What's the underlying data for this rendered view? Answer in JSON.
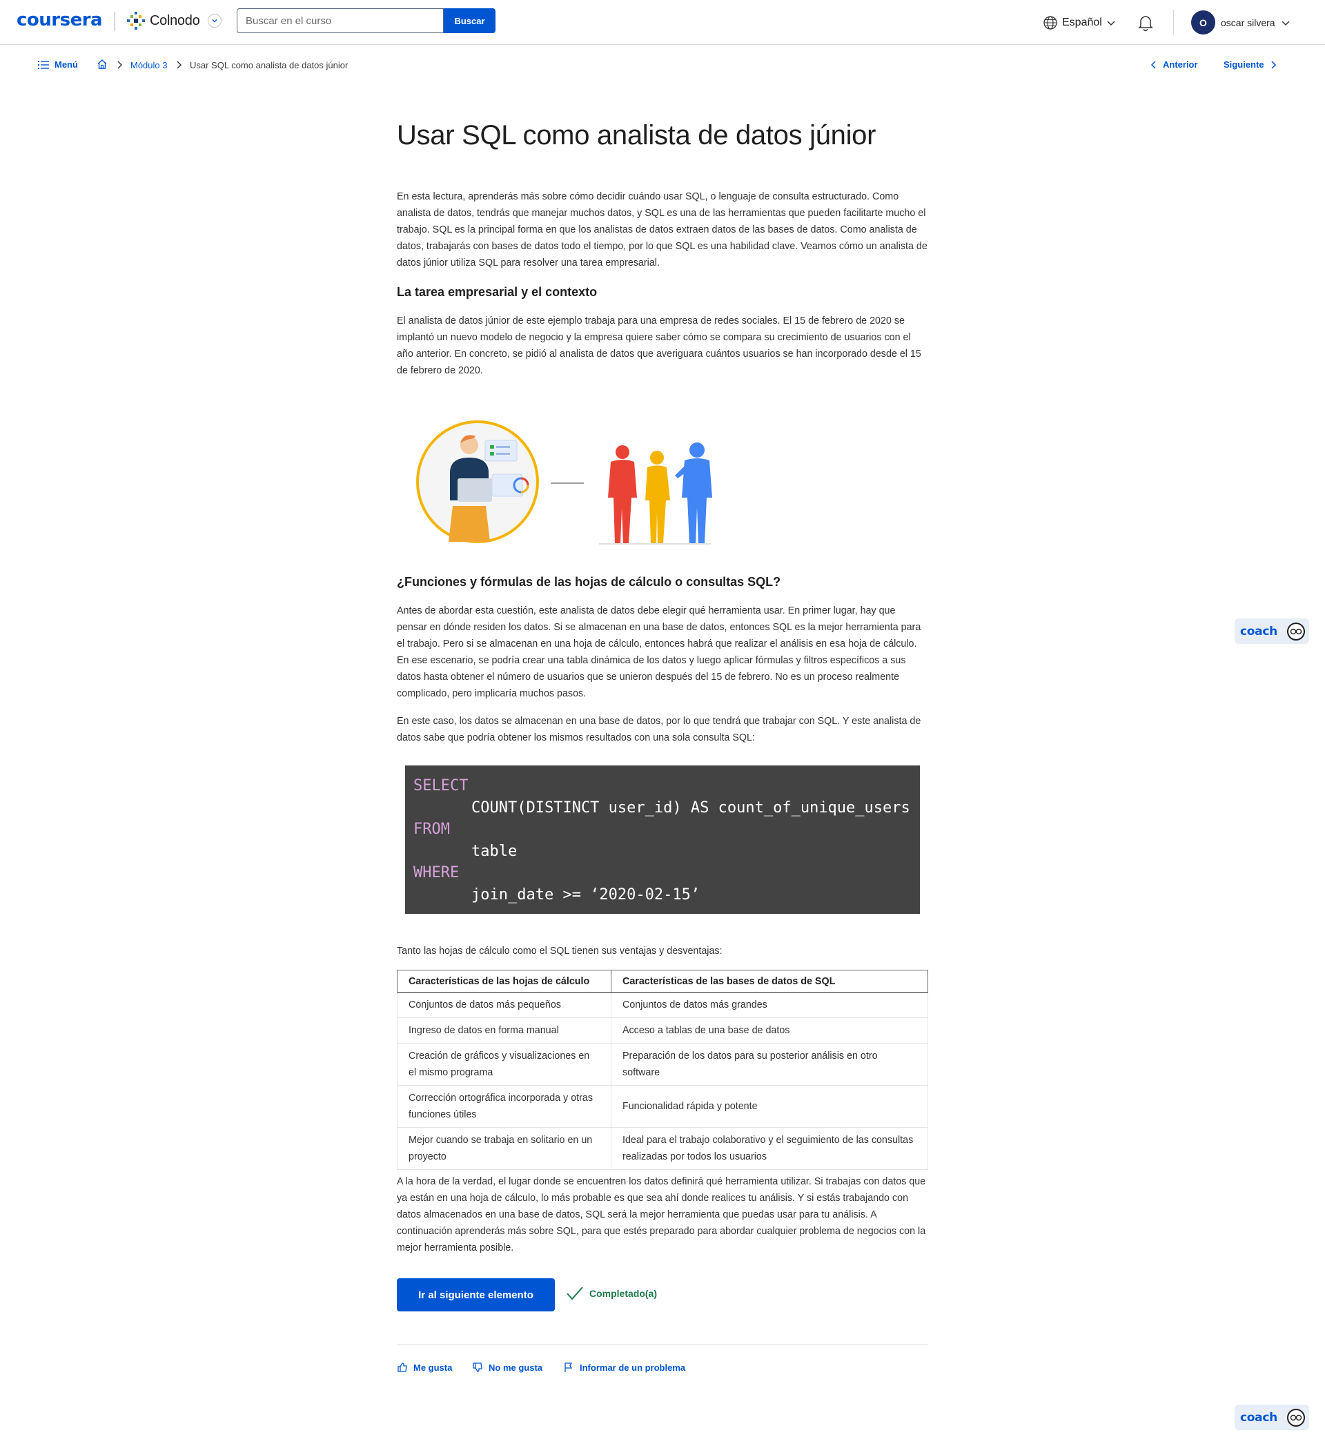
{
  "header": {
    "logo": "coursera",
    "partner": "Colnodo",
    "search_placeholder": "Buscar en el curso",
    "search_button": "Buscar",
    "language": "Español",
    "user_initial": "O",
    "user_name": "oscar silvera"
  },
  "breadcrumb": {
    "menu": "Menú",
    "module": "Módulo 3",
    "current": "Usar SQL como analista de datos júnior",
    "prev": "Anterior",
    "next": "Siguiente"
  },
  "article": {
    "title": "Usar SQL como analista de datos júnior",
    "intro": "En esta lectura, aprenderás más sobre cómo decidir cuándo usar SQL, o lenguaje de consulta estructurado. Como analista de datos, tendrás que manejar muchos datos, y SQL es una de las herramientas que pueden facilitarte mucho el trabajo. SQL es la principal forma en que los analistas de datos extraen datos de las bases de datos. Como analista de datos, trabajarás con bases de datos todo el tiempo, por lo que SQL es una habilidad clave. Veamos cómo un analista de datos júnior utiliza SQL para resolver una tarea empresarial.",
    "h_context": "La tarea empresarial y el contexto",
    "p_context": "El analista de datos júnior de este ejemplo trabaja para una empresa de redes sociales. El 15 de febrero de 2020 se implantó un nuevo modelo de negocio y la empresa quiere saber cómo se compara su crecimiento de usuarios con el año anterior. En concreto, se pidió al analista de datos que averiguara cuántos usuarios se han incorporado desde el 15 de febrero de 2020.",
    "h_question": "¿Funciones y fórmulas de las hojas de cálculo o consultas SQL?",
    "p_question": "Antes de abordar esta cuestión, este analista de datos debe elegir qué herramienta usar. En primer lugar, hay que pensar en dónde residen los datos. Si se almacenan en una base de datos, entonces SQL es la mejor herramienta para el trabajo. Pero si se almacenan en una hoja de cálculo, entonces habrá que realizar el análisis en esa hoja de cálculo. En ese escenario, se podría crear una tabla dinámica de los datos y luego aplicar fórmulas y filtros específicos a sus datos hasta obtener el número de usuarios que se unieron después del 15 de febrero. No es un proceso realmente complicado, pero implicaría muchos pasos.",
    "p_case": "En este caso, los datos se almacenan en una base de datos, por lo que tendrá que trabajar con SQL. Y este analista de datos sabe que podría obtener los mismos resultados con una sola consulta SQL:",
    "code": {
      "kw1": "SELECT",
      "line1": "COUNT(DISTINCT user_id) AS count_of_unique_users",
      "kw2": "FROM",
      "line2": "table",
      "kw3": "WHERE",
      "line3": "join_date >= ‘2020-02-15’"
    },
    "p_table_intro": "Tanto las hojas de cálculo como el SQL tienen sus ventajas y desventajas:",
    "table": {
      "headers": [
        "Características de las hojas de cálculo",
        "Características de las bases de datos de SQL"
      ],
      "rows": [
        [
          "Conjuntos de datos más pequeños",
          "Conjuntos de datos más grandes"
        ],
        [
          "Ingreso de datos en forma manual",
          "Acceso a tablas de una base de datos"
        ],
        [
          "Creación de gráficos y visualizaciones en el mismo programa",
          "Preparación de los datos para su posterior análisis en otro software"
        ],
        [
          "Corrección ortográfica incorporada y otras funciones útiles",
          "Funcionalidad rápida y potente"
        ],
        [
          "Mejor cuando se trabaja en solitario en un proyecto",
          "Ideal para el trabajo colaborativo y el seguimiento de las consultas realizadas por todos los usuarios"
        ]
      ]
    },
    "p_conclusion": "A la hora de la verdad, el lugar donde se encuentren los datos definirá qué herramienta utilizar. Si trabajas con datos que ya están en una hoja de cálculo, lo más probable es que sea ahí donde realices tu análisis. Y si estás trabajando con datos almacenados en una base de datos, SQL será la mejor herramienta que puedas usar para tu análisis. A continuación aprenderás más sobre SQL, para que estés preparado para abordar cualquier problema de negocios con la mejor herramienta posible."
  },
  "actions": {
    "next_item": "Ir al siguiente elemento",
    "completed": "Completado(a)",
    "like": "Me gusta",
    "dislike": "No me gusta",
    "report": "Informar de un problema"
  },
  "coach": {
    "label": "coach"
  },
  "colors": {
    "brand": "#0056d2",
    "code_bg": "#434343",
    "keyword": "#d3a1d7",
    "success": "#1e7b4b"
  }
}
